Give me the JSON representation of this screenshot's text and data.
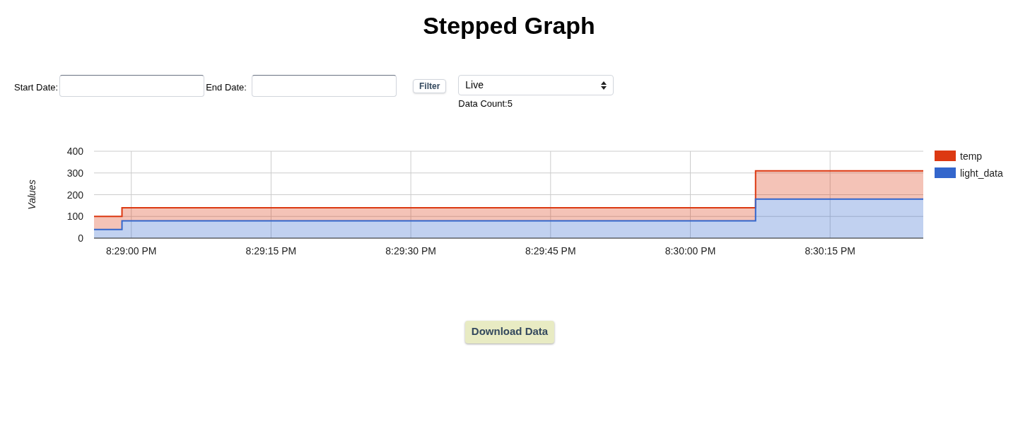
{
  "title": "Stepped Graph",
  "filters": {
    "start_label": "Start Date:",
    "end_label": "End Date:",
    "filter_button": "Filter",
    "mode": "Live",
    "data_count": "Data Count:5"
  },
  "chart": {
    "chart_data": {
      "type": "area",
      "stacked": true,
      "grid": true,
      "legend": "right",
      "ylabel": "Values",
      "x": [
        73736,
        73739,
        73739,
        73799,
        73807,
        73807,
        73825
      ],
      "xlim": [
        73736,
        73825
      ],
      "ylim": [
        0,
        400
      ],
      "yticks": [
        0,
        100,
        200,
        300,
        400
      ],
      "xticks": [
        {
          "value": 73740,
          "label": "8:29:00 PM"
        },
        {
          "value": 73755,
          "label": "8:29:15 PM"
        },
        {
          "value": 73770,
          "label": "8:29:30 PM"
        },
        {
          "value": 73785,
          "label": "8:29:45 PM"
        },
        {
          "value": 73800,
          "label": "8:30:00 PM"
        },
        {
          "value": 73815,
          "label": "8:30:15 PM"
        }
      ],
      "series": [
        {
          "name": "temp",
          "color": "#dc3912",
          "values": [
            60,
            60,
            60,
            60,
            60,
            130,
            130
          ]
        },
        {
          "name": "light_data",
          "color": "#3366cc",
          "values": [
            40,
            40,
            80,
            80,
            80,
            180,
            180
          ]
        }
      ]
    }
  },
  "download_button": "Download Data"
}
